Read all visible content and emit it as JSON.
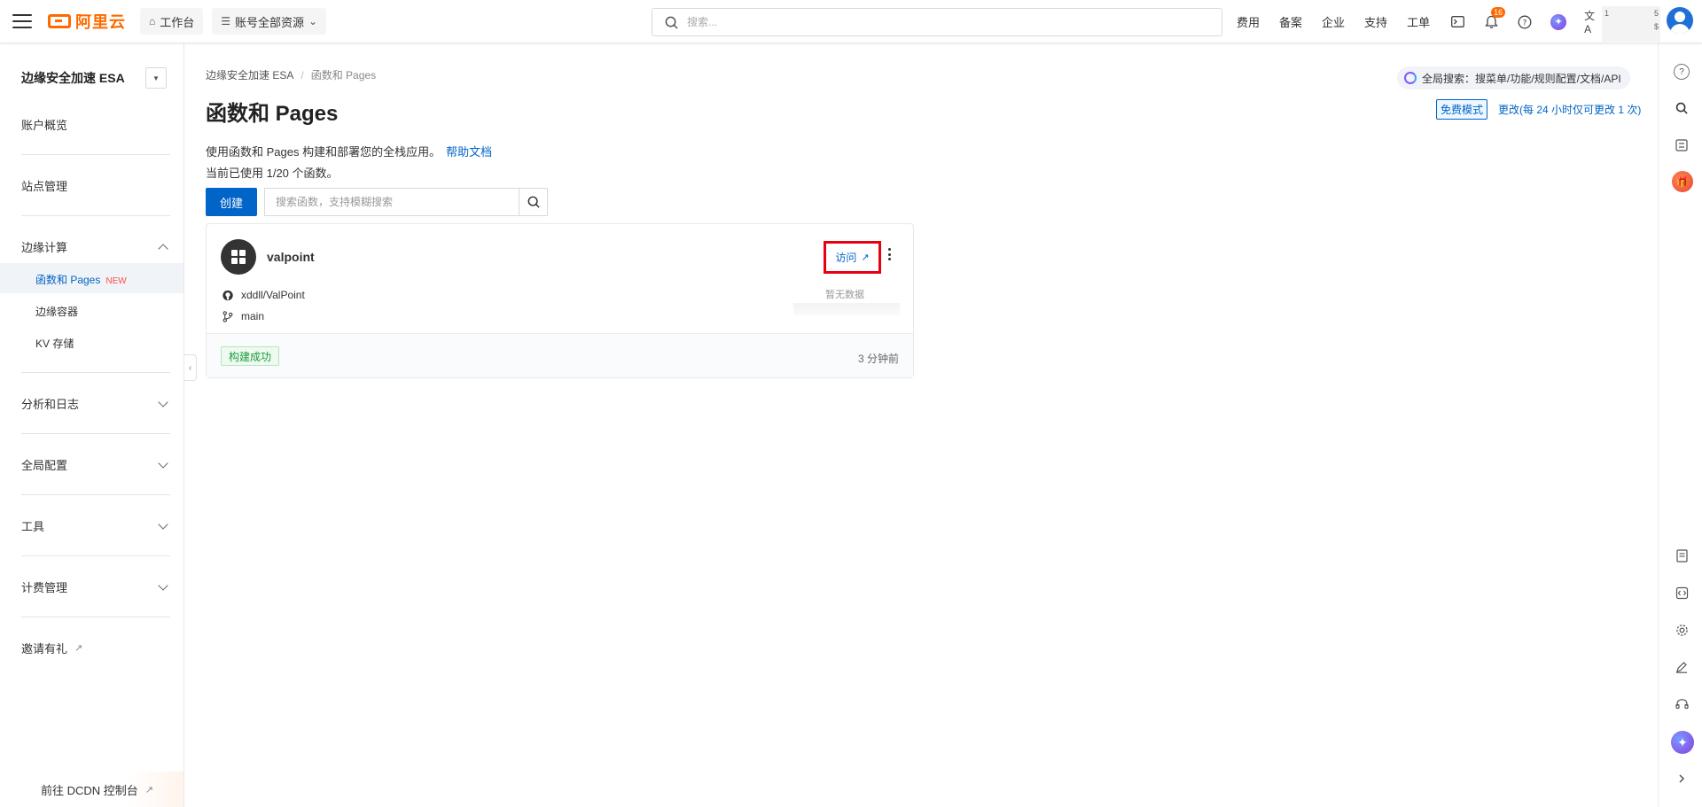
{
  "brand": {
    "logo_text": "阿里云",
    "accent": "#ff6a00"
  },
  "topbar": {
    "workbench": "工作台",
    "resources": "账号全部资源",
    "search_placeholder": "搜索...",
    "links": [
      "费用",
      "备案",
      "企业",
      "支持",
      "工单"
    ],
    "notification_count": "16",
    "user_fragments": [
      "1",
      "5",
      "$"
    ]
  },
  "sidebar": {
    "title": "边缘安全加速 ESA",
    "overview": "账户概览",
    "site_mgmt": "站点管理",
    "edge_compute": "边缘计算",
    "sub_functions": "函数和 Pages",
    "new_tag": "NEW",
    "sub_container": "边缘容器",
    "sub_kv": "KV 存储",
    "analytics": "分析和日志",
    "global_config": "全局配置",
    "tools": "工具",
    "billing": "计费管理",
    "invite": "邀请有礼",
    "footer": "前往 DCDN 控制台"
  },
  "main": {
    "breadcrumb": [
      "边缘安全加速 ESA",
      "/",
      "函数和 Pages"
    ],
    "title": "函数和 Pages",
    "global_search": "全局搜索：搜菜单/功能/规则配置/文档/API",
    "mode_tag": "免费模式",
    "mode_link": "更改(每 24 小时仅可更改 1 次)",
    "desc": "使用函数和 Pages 构建和部署您的全栈应用。",
    "help_link": "帮助文档",
    "usage": "当前已使用 1/20 个函数。",
    "create_button": "创建",
    "search_placeholder": "搜索函数，支持模糊搜索"
  },
  "card": {
    "name": "valpoint",
    "visit": "访问",
    "repo": "xddll/ValPoint",
    "branch": "main",
    "no_data": "暂无数据",
    "status": "构建成功",
    "time_ago": "3 分钟前"
  }
}
